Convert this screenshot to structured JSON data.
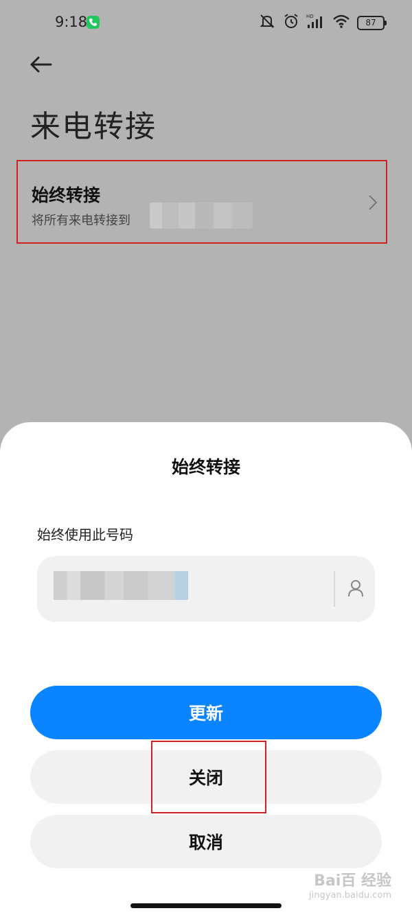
{
  "status_bar": {
    "time": "9:18",
    "battery": "87",
    "icons": [
      "phone-call-icon",
      "mute-icon",
      "alarm-icon",
      "hd-signal-icon",
      "wifi-icon",
      "battery-icon"
    ]
  },
  "header": {
    "back_icon": "back-arrow-icon",
    "title": "来电转接"
  },
  "setting": {
    "title": "始终转接",
    "subtitle": "将所有来电转接到",
    "chevron_icon": "chevron-right-icon"
  },
  "dialog": {
    "title": "始终转接",
    "field_label": "始终使用此号码",
    "contact_icon": "contact-person-icon",
    "buttons": {
      "update": "更新",
      "close": "关闭",
      "cancel": "取消"
    }
  },
  "watermark": {
    "brand": "Bai百 经验",
    "url": "jingyan.baidu.com"
  },
  "colors": {
    "primary": "#0a84ff",
    "highlight": "#d21f1f",
    "overlay_bg": "#b3b3b3"
  }
}
